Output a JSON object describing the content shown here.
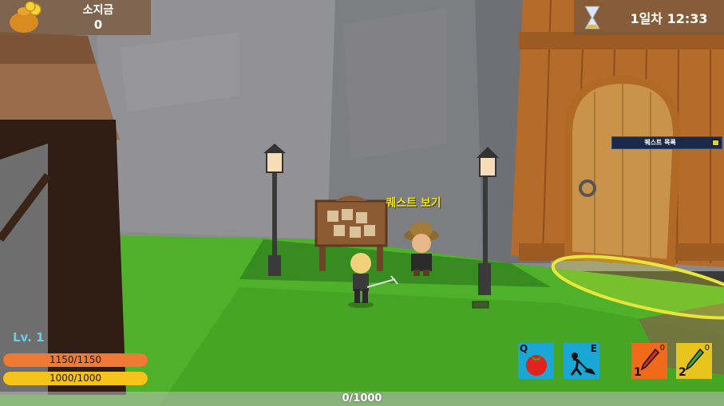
{
  "hud": {
    "gold": {
      "label": "소지금",
      "value": "0"
    },
    "time": {
      "text": "1일차 12:33"
    },
    "quest_list": {
      "title": "퀘스트 목록"
    },
    "npc_label": "퀘스트 보기",
    "level": "Lv.  1",
    "hp": {
      "text": "1150/1150",
      "fraction": 1.0
    },
    "mp": {
      "text": "1000/1000",
      "fraction": 1.0
    },
    "exp": {
      "text": "0/1000",
      "fraction": 0.0
    }
  },
  "skills": [
    {
      "key": "Q",
      "icon": "tomato-icon"
    },
    {
      "key": "E",
      "icon": "dig-icon"
    }
  ],
  "quickslots": [
    {
      "num": "1",
      "count": "0",
      "icon": "red-pencil-icon"
    },
    {
      "num": "2",
      "count": "0",
      "icon": "green-pencil-icon"
    }
  ],
  "colors": {
    "grass": "#4fb12a",
    "hud_panel": "#785a3c",
    "quest_text": "#f3e600"
  }
}
